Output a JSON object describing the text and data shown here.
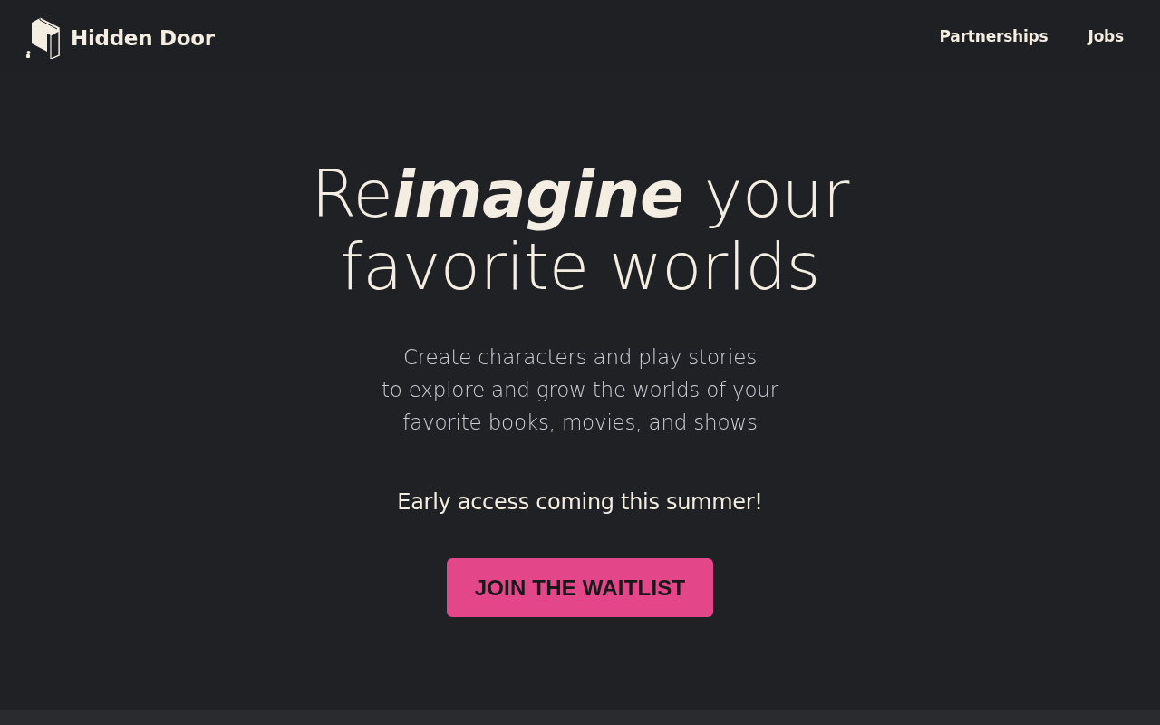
{
  "header": {
    "brand": "Hidden Door",
    "nav": [
      {
        "label": "Partnerships"
      },
      {
        "label": "Jobs"
      }
    ]
  },
  "hero": {
    "headline_lines": [
      "Re**imagine** your",
      "favorite worlds"
    ],
    "subtitle_lines": [
      "Create characters and play stories",
      "to explore and grow the worlds of your",
      "favorite books, movies, and shows"
    ],
    "announcement": "Early access coming this summer!",
    "cta": "JOIN THE WAITLIST"
  }
}
